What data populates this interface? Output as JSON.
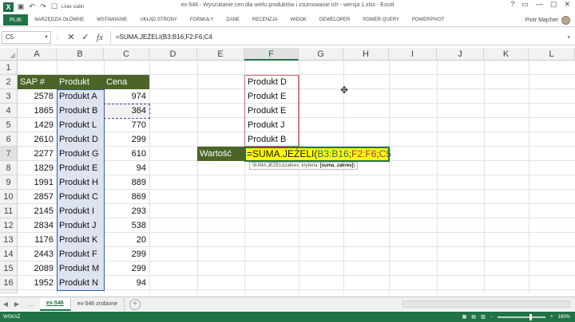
{
  "window": {
    "title": "ex-546 - Wyszukanie cen dla wielu produktów i zsumowanie ich - wersja 1.xlsx - Excel",
    "qat_extra_label": "Linie siatki",
    "controls": [
      "?",
      "▭",
      "—",
      "▢",
      "✕"
    ]
  },
  "ribbon": {
    "file_tab": "PLIK",
    "tabs": [
      "NARZĘDZIA GŁÓWNE",
      "WSTAWIANIE",
      "UKŁAD STRONY",
      "FORMUŁY",
      "DANE",
      "RECENZJA",
      "WIDOK",
      "DEWELOPER",
      "POWER QUERY",
      "POWERPIVOT"
    ],
    "user_name": "Piotr Majcher"
  },
  "formula_bar": {
    "name_box": "C5",
    "cancel_icon": "✕",
    "enter_icon": "✓",
    "fx_label": "fx",
    "formula": "=SUMA.JEŻELI(B3:B16;F2:F6;C4"
  },
  "columns": [
    "A",
    "B",
    "C",
    "D",
    "E",
    "F",
    "G",
    "H",
    "I",
    "J",
    "K",
    "L"
  ],
  "rows": [
    "1",
    "2",
    "3",
    "4",
    "5",
    "6",
    "7",
    "8",
    "9",
    "10",
    "11",
    "12",
    "13",
    "14",
    "15",
    "16",
    "17"
  ],
  "table": {
    "headers": [
      "SAP #",
      "Produkt",
      "Cena"
    ],
    "rows": [
      [
        "2578",
        "Produkt A",
        "974"
      ],
      [
        "1865",
        "Produkt B",
        "364"
      ],
      [
        "1429",
        "Produkt L",
        "770"
      ],
      [
        "2610",
        "Produkt D",
        "299"
      ],
      [
        "2277",
        "Produkt G",
        "610"
      ],
      [
        "1829",
        "Produkt E",
        "94"
      ],
      [
        "1991",
        "Produkt H",
        "889"
      ],
      [
        "2857",
        "Produkt C",
        "869"
      ],
      [
        "2145",
        "Produkt I",
        "293"
      ],
      [
        "2834",
        "Produkt J",
        "538"
      ],
      [
        "1176",
        "Produkt K",
        "20"
      ],
      [
        "2443",
        "Produkt F",
        "299"
      ],
      [
        "2089",
        "Produkt M",
        "299"
      ],
      [
        "1952",
        "Produkt N",
        "94"
      ]
    ]
  },
  "criteria": [
    "Produkt D",
    "Produkt E",
    "Produkt E",
    "Produkt J",
    "Produkt B"
  ],
  "wartosc_label": "Wartość",
  "edit_cell": {
    "part1": "=SUMA.JEŻELI(",
    "part2": "B3:B16",
    "sep1": ";",
    "part3": "F2:F6",
    "sep2": ";",
    "part4": "C5"
  },
  "tooltip": {
    "text": "SUMA.JEŻELI(zakres; kryteria; ",
    "bold": "[suma_zakres]",
    "close": ")"
  },
  "sheets": [
    "ex-546",
    "ex-546 zrobione"
  ],
  "status": {
    "mode": "WSKAŻ",
    "zoom": "160%"
  }
}
